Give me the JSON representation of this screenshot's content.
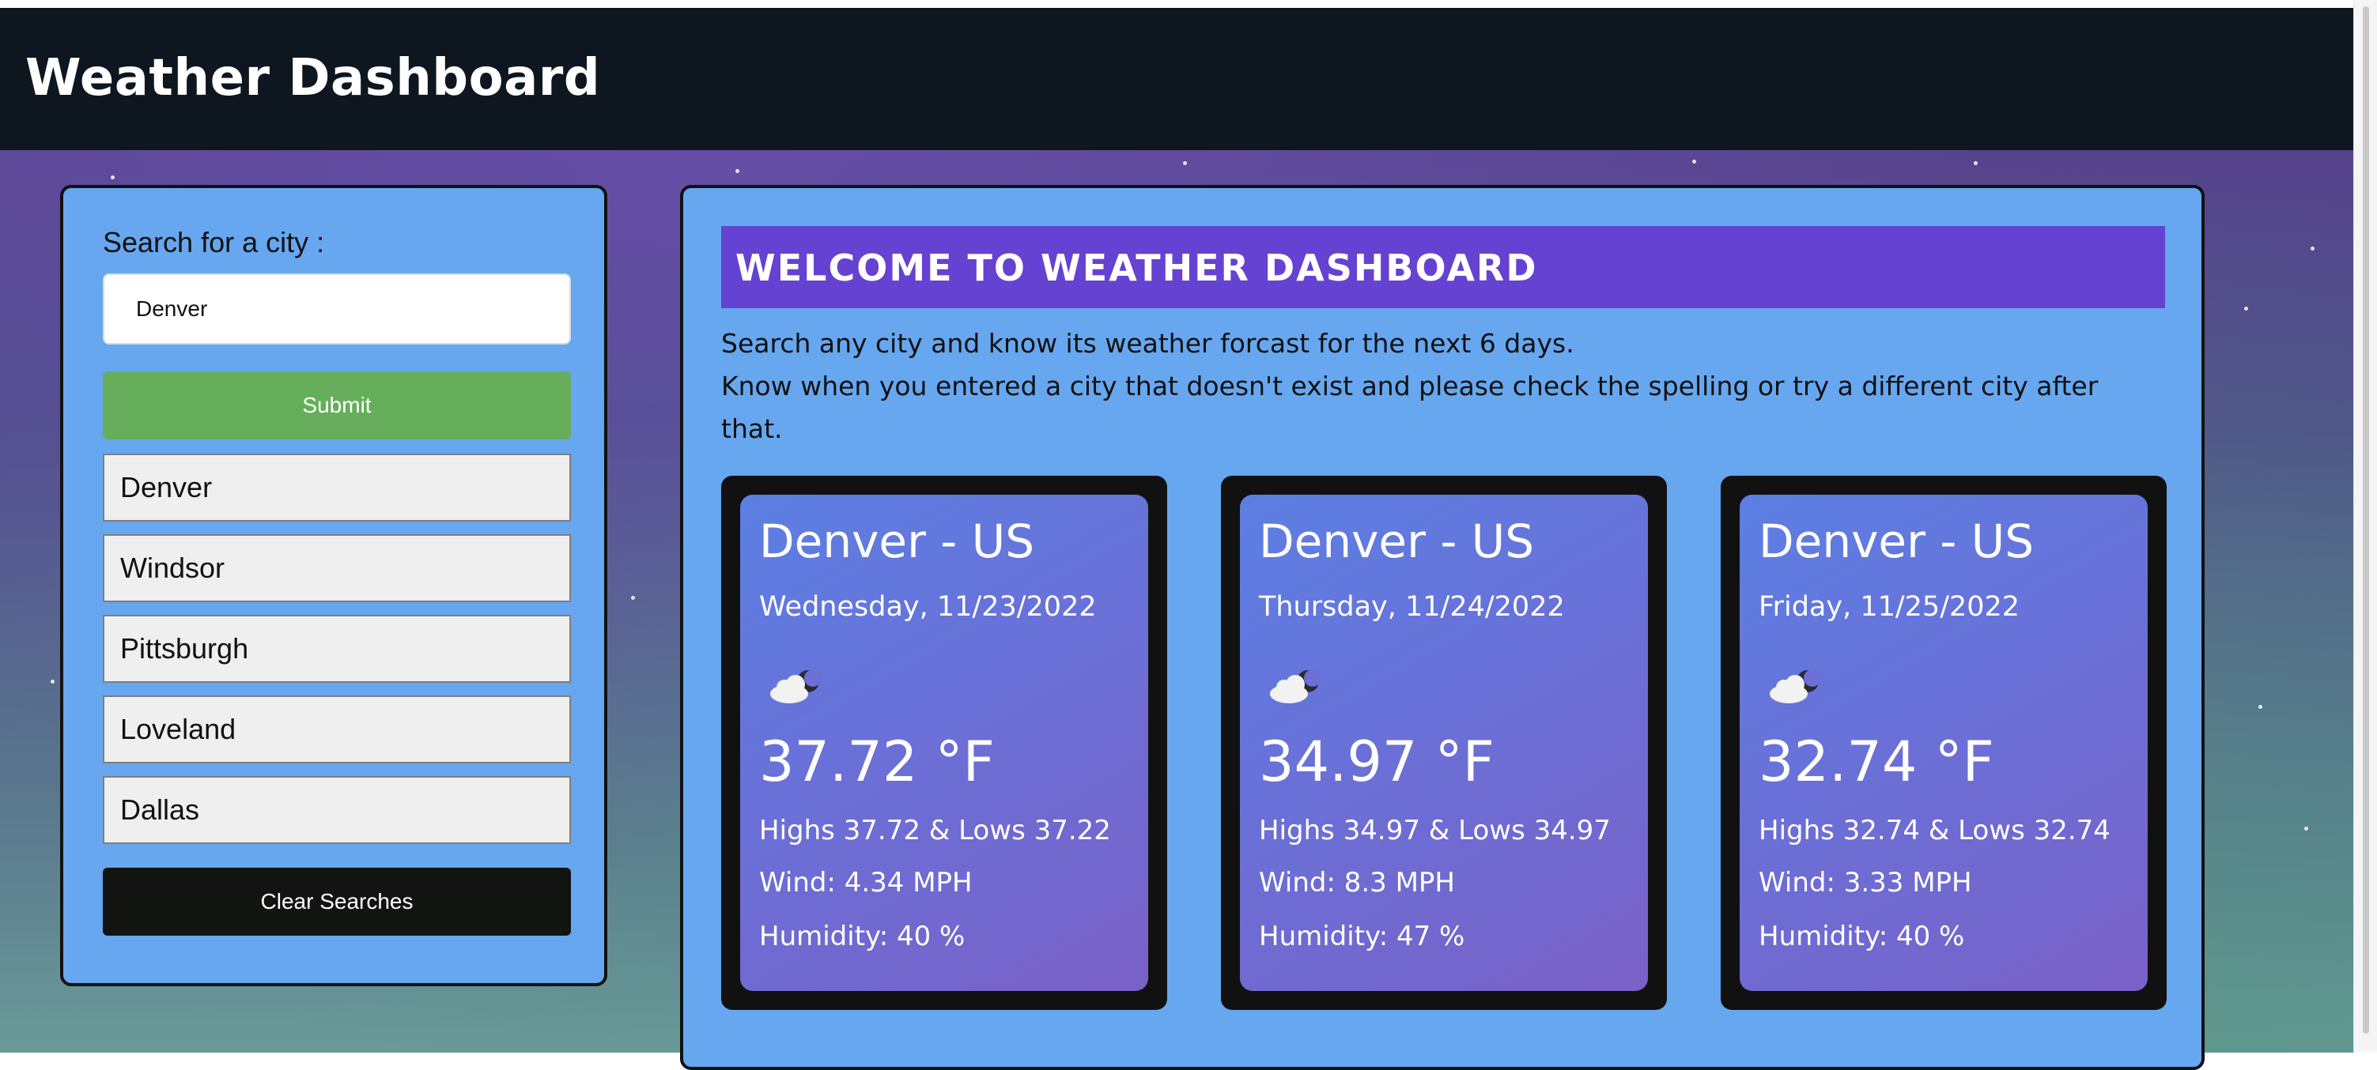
{
  "header": {
    "title": "Weather Dashboard"
  },
  "sidebar": {
    "search_label": "Search for a city :",
    "search_value": "Denver",
    "submit_label": "Submit",
    "history": [
      "Denver",
      "Windsor",
      "Pittsburgh",
      "Loveland",
      "Dallas"
    ],
    "clear_label": "Clear Searches"
  },
  "main": {
    "banner": "WELCOME TO WEATHER DASHBOARD",
    "intro_line1": "Search any city and know its weather forcast for the next 6 days.",
    "intro_line2": "Know when you entered a city that doesn't exist and please check the spelling or try a different city after",
    "intro_line3": "that.",
    "cards": [
      {
        "city": "Denver - US",
        "date": "Wednesday, 11/23/2022",
        "icon": "partly-cloudy-night-icon",
        "temp": "37.72 °F",
        "highs_lows": "Highs 37.72 & Lows 37.22",
        "wind": "Wind: 4.34 MPH",
        "humidity": "Humidity: 40 %"
      },
      {
        "city": "Denver - US",
        "date": "Thursday, 11/24/2022",
        "icon": "partly-cloudy-night-icon",
        "temp": "34.97 °F",
        "highs_lows": "Highs 34.97 & Lows 34.97",
        "wind": "Wind: 8.3 MPH",
        "humidity": "Humidity: 47 %"
      },
      {
        "city": "Denver - US",
        "date": "Friday, 11/25/2022",
        "icon": "partly-cloudy-night-icon",
        "temp": "32.74 °F",
        "highs_lows": "Highs 32.74 & Lows 32.74",
        "wind": "Wind: 3.33 MPH",
        "humidity": "Humidity: 40 %"
      }
    ]
  },
  "colors": {
    "header_bg": "#0e1720",
    "panel_bg": "#66a7ef",
    "banner_bg": "#6542d1",
    "submit_bg": "#67ae5c",
    "clear_bg": "#111411"
  }
}
